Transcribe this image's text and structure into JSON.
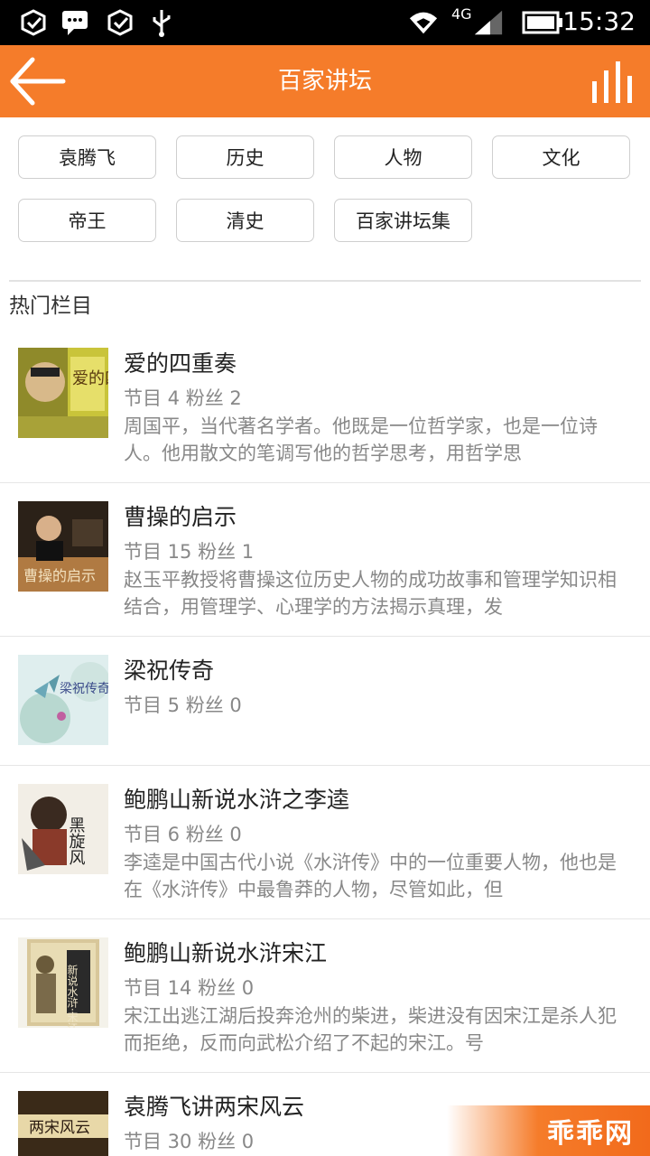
{
  "status_bar": {
    "network": "4G",
    "time": "15:32",
    "icons": [
      "notification-check-icon",
      "message-icon",
      "notification-check-icon",
      "usb-icon",
      "wifi-icon",
      "signal-icon",
      "battery-icon"
    ]
  },
  "header": {
    "title": "百家讲坛",
    "back_icon": "arrow-left-icon",
    "right_icon": "equalizer-icon"
  },
  "tags": [
    "袁腾飞",
    "历史",
    "人物",
    "文化",
    "帝王",
    "清史",
    "百家讲坛集"
  ],
  "section": {
    "title": "热门栏目"
  },
  "items": [
    {
      "title": "爱的四重奏",
      "meta": "节目 4 粉丝 2",
      "desc": "周国平，当代著名学者。他既是一位哲学家，也是一位诗人。他用散文的笔调写他的哲学思考，用哲学思",
      "cover_text": "爱的四重奏"
    },
    {
      "title": "曹操的启示",
      "meta": "节目 15 粉丝 1",
      "desc": "赵玉平教授将曹操这位历史人物的成功故事和管理学知识相结合，用管理学、心理学的方法揭示真理，发",
      "cover_text": "曹操的启示"
    },
    {
      "title": "梁祝传奇",
      "meta": "节目 5 粉丝 0",
      "desc": "",
      "cover_text": "梁祝传奇"
    },
    {
      "title": "鲍鹏山新说水浒之李逵",
      "meta": "节目 6 粉丝 0",
      "desc": "李逵是中国古代小说《水浒传》中的一位重要人物，他也是在《水浒传》中最鲁莽的人物，尽管如此，但",
      "cover_text": "黑旋风"
    },
    {
      "title": "鲍鹏山新说水浒宋江",
      "meta": "节目 14 粉丝 0",
      "desc": "宋江出逃江湖后投奔沧州的柴进，柴进没有因宋江是杀人犯而拒绝，反而向武松介绍了不起的宋江。号",
      "cover_text": "新说水浒·宋江"
    },
    {
      "title": "袁腾飞讲两宋风云",
      "meta": "节目 30 粉丝 0",
      "desc": "",
      "cover_text": "两宋风云"
    }
  ],
  "watermark": "乖乖网",
  "colors": {
    "accent": "#f57c2a",
    "meta_text": "#888888"
  }
}
